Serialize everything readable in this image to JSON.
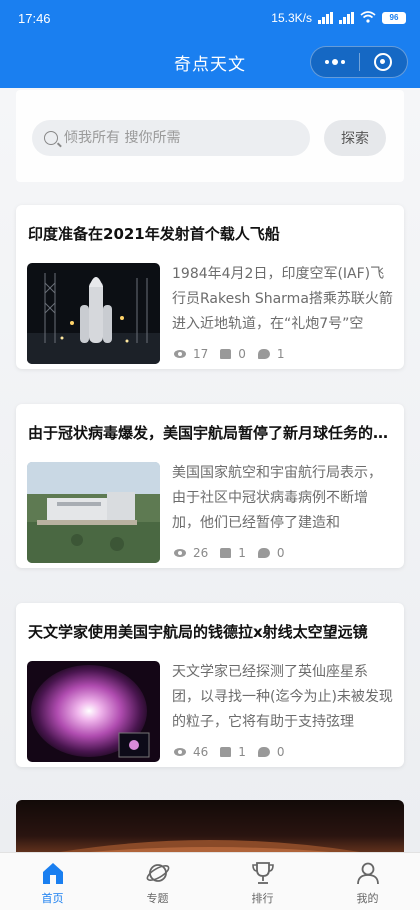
{
  "status_bar": {
    "time": "17:46",
    "network_speed": "15.3K/s",
    "battery": "96"
  },
  "header": {
    "title": "奇点天文"
  },
  "search": {
    "placeholder": "倾我所有 搜你所需",
    "button_label": "探索"
  },
  "articles": [
    {
      "title": "印度准备在2021年发射首个载人飞船",
      "excerpt": "1984年4月2日，印度空军(IAF)飞行员Rakesh Sharma搭乘苏联火箭进入近地轨道，在“礼炮7号”空",
      "views": "17",
      "likes": "0",
      "comments": "1",
      "thumb_icon": "rocket-launch-image"
    },
    {
      "title": "由于冠状病毒爆发，美国宇航局暂停了新月球任务的工作",
      "excerpt": "美国国家航空和宇宙航行局表示，由于社区中冠状病毒病例不断增加，他们已经暂停了建造和",
      "views": "26",
      "likes": "1",
      "comments": "0",
      "thumb_icon": "facility-aerial-image"
    },
    {
      "title": "天文学家使用美国宇航局的钱德拉x射线太空望远镜",
      "excerpt": "天文学家已经探测了英仙座星系团，以寻找一种(迄今为止)未被发现的粒子，它将有助于支持弦理",
      "views": "46",
      "likes": "1",
      "comments": "0",
      "thumb_icon": "galaxy-cluster-image"
    }
  ],
  "tabbar": {
    "items": [
      {
        "label": "首页",
        "icon": "home-icon",
        "active": true
      },
      {
        "label": "专题",
        "icon": "planet-icon",
        "active": false
      },
      {
        "label": "排行",
        "icon": "trophy-icon",
        "active": false
      },
      {
        "label": "我的",
        "icon": "user-icon",
        "active": false
      }
    ]
  },
  "colors": {
    "primary": "#1a7ff0",
    "text_muted": "#6c6c6c"
  }
}
